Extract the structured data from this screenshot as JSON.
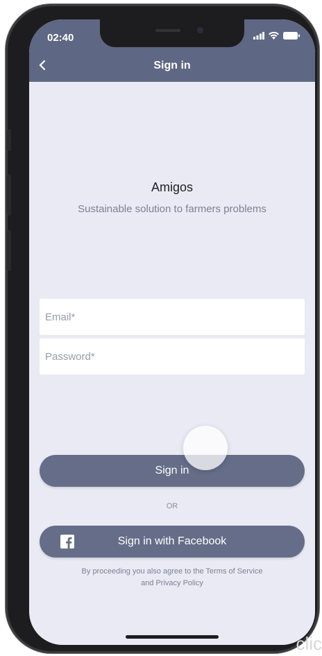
{
  "status": {
    "time": "02:40",
    "icons": [
      "signal-icon",
      "wifi-icon",
      "battery-icon"
    ]
  },
  "navbar": {
    "back_icon": "back-chevron-icon",
    "title": "Sign in"
  },
  "app": {
    "name": "Amigos",
    "tagline": "Sustainable solution to farmers problems"
  },
  "form": {
    "email_placeholder": "Email*",
    "password_placeholder": "Password*",
    "sign_in_label": "Sign in",
    "or_label": "OR",
    "facebook_label": "Sign in with Facebook",
    "terms_line1": "By proceeding you also agree to the Terms of Service",
    "terms_line2": "and Privacy Policy"
  },
  "colors": {
    "accent": "#5e6784",
    "button": "#656d88",
    "background": "#e9eaf4"
  },
  "watermark": "clic"
}
